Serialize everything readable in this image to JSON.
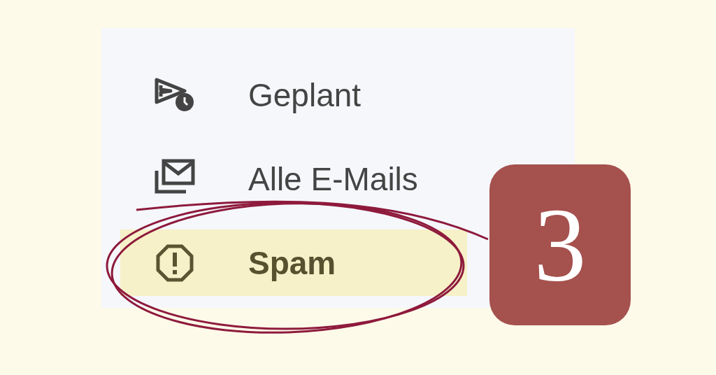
{
  "sidebar": {
    "items": [
      {
        "kind": "scheduled",
        "label": "Geplant",
        "highlighted": false
      },
      {
        "kind": "all_mail",
        "label": "Alle E-Mails",
        "highlighted": false
      },
      {
        "kind": "spam",
        "label": "Spam",
        "highlighted": true
      }
    ]
  },
  "step_badge": {
    "label": "3"
  }
}
